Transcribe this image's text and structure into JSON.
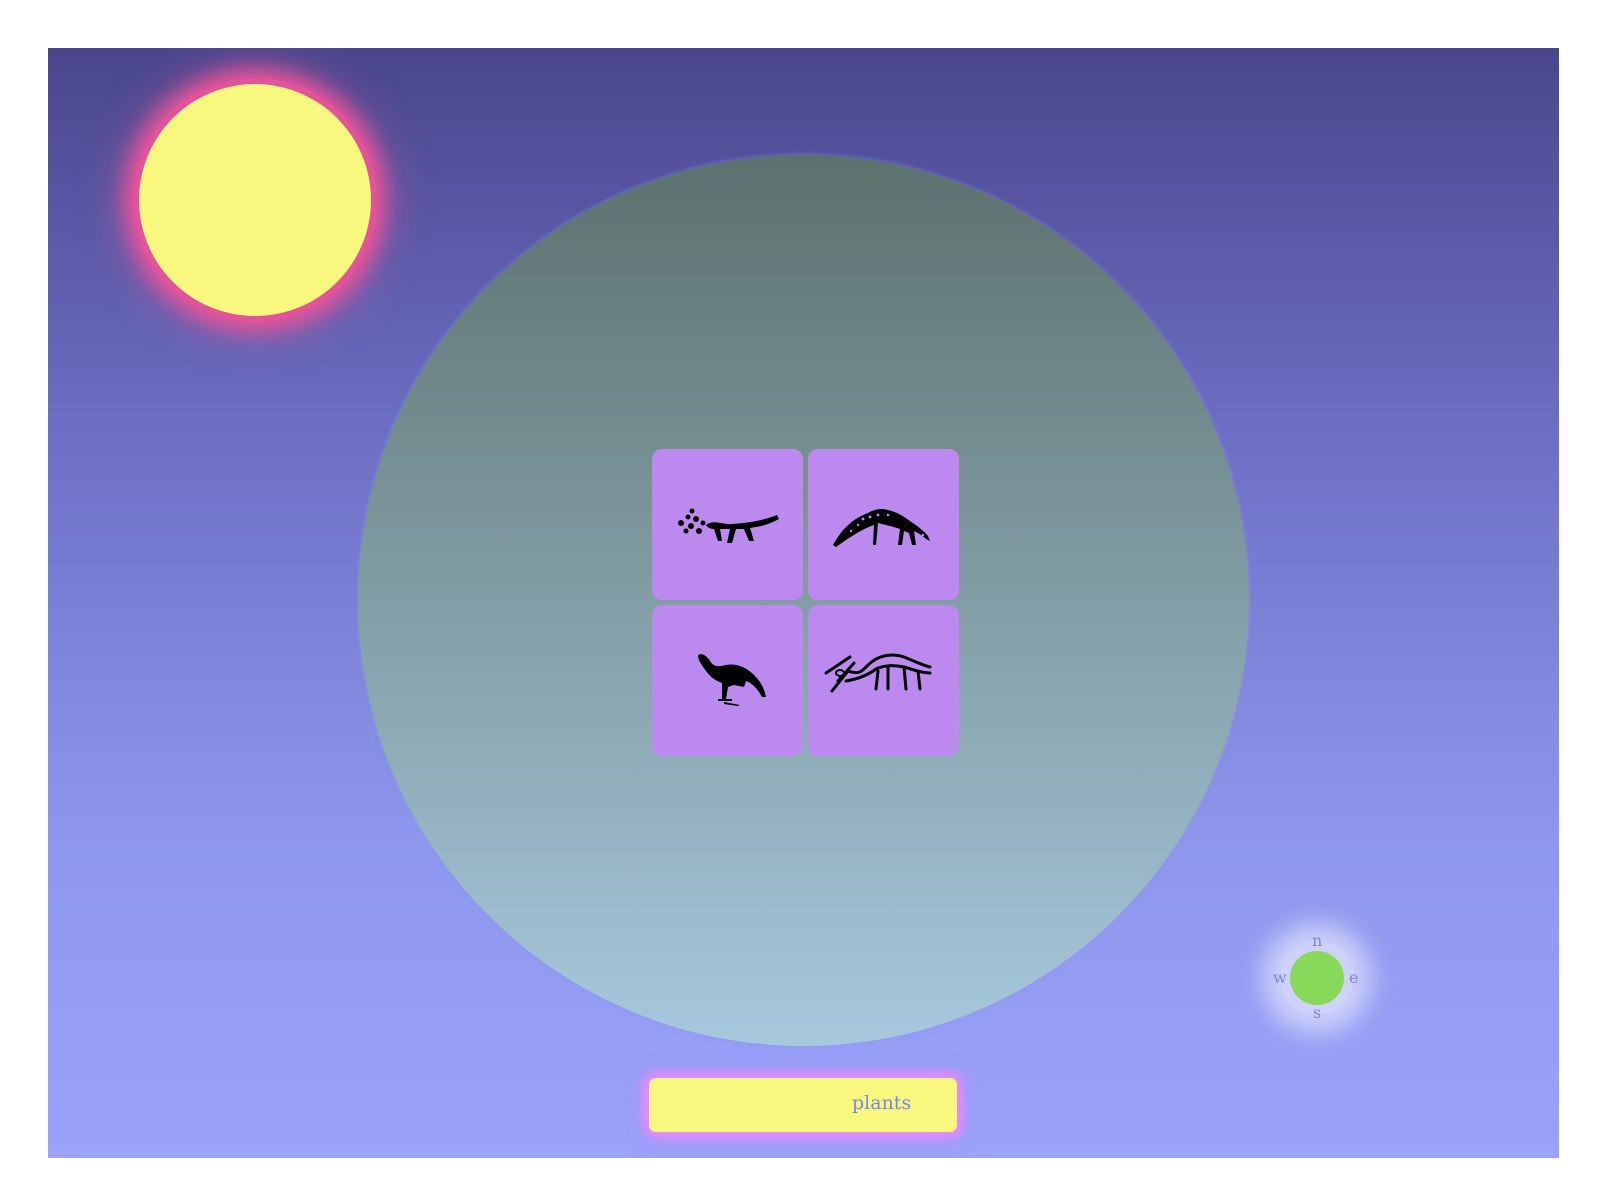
{
  "game": {
    "tiles": [
      {
        "name": "tile-cave-animal-with-dots",
        "icon": "petroglyph-beast-with-dots-icon"
      },
      {
        "name": "tile-cave-deer-spotted",
        "icon": "petroglyph-grazing-deer-icon"
      },
      {
        "name": "tile-cave-long-neck-creature",
        "icon": "petroglyph-long-neck-animal-icon"
      },
      {
        "name": "tile-cave-horned-animal",
        "icon": "petroglyph-horned-animal-icon"
      }
    ],
    "category_bar": {
      "label": "plants"
    },
    "compass": {
      "n": "n",
      "s": "s",
      "w": "w",
      "e": "e"
    }
  },
  "colors": {
    "sky_top": "#4a468c",
    "sky_bottom": "#9ba2fb",
    "sun": "#f8f87f",
    "sun_glow": "#e2549a",
    "world_top": "#5b716d",
    "world_bottom": "#a7c8dd",
    "tile": "#bc8aee",
    "bar": "#f8f87f",
    "bar_glow": "#ef86ff",
    "compass": "#88d85a",
    "text": "#7a86e6"
  }
}
